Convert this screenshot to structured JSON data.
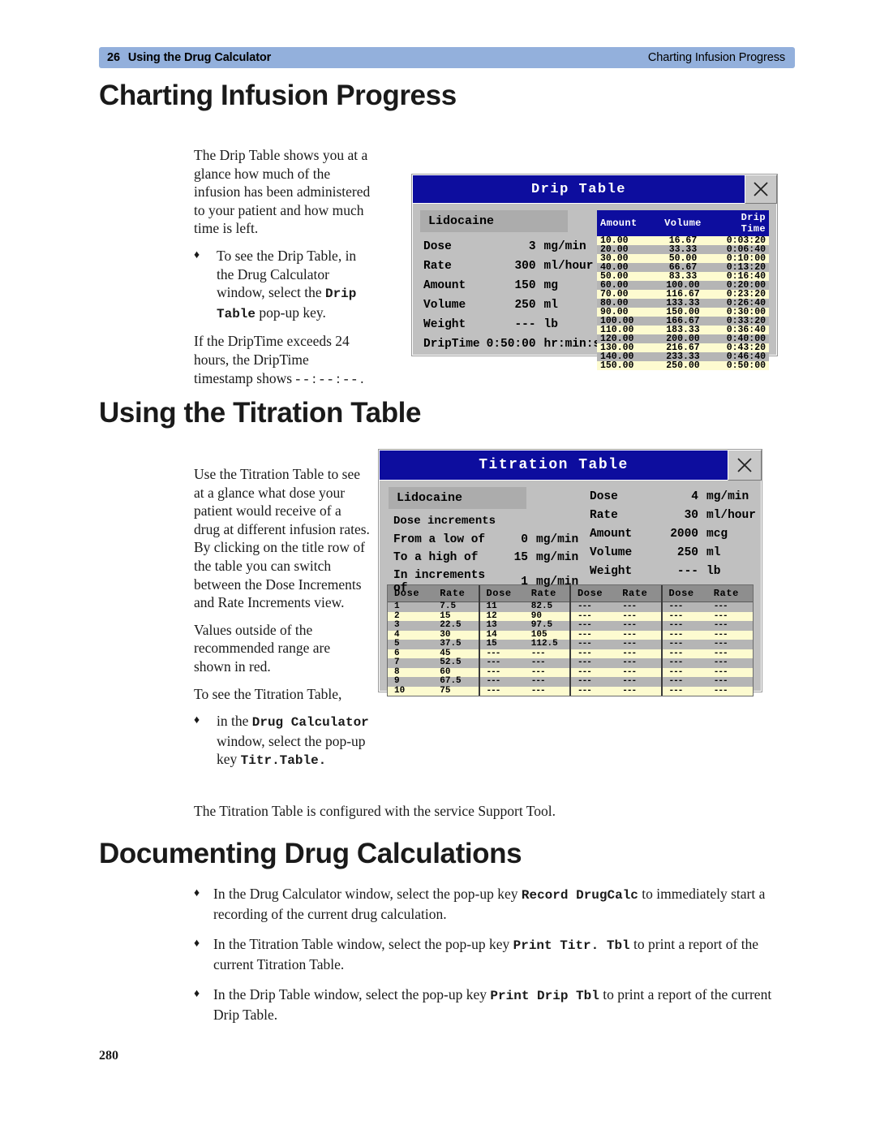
{
  "running_header": {
    "folio": "26",
    "chapter": "Using the Drug Calculator",
    "section": "Charting Infusion Progress"
  },
  "headings": {
    "charting": "Charting Infusion Progress",
    "titration": "Using the Titration Table",
    "documenting": "Documenting Drug Calculations"
  },
  "page_number": "280",
  "charting_section": {
    "para1": "The Drip Table shows you at a glance how much of the infusion has been administered to your patient and how much time is left.",
    "bullet_mark": "♦",
    "bullet1_pre": "To see the Drip Table, in the Drug Calculator window, select the ",
    "bullet1_mono": "Drip Table",
    "bullet1_post": " pop-up key.",
    "para2": "If the DripTime exceeds 24 hours, the DripTime timestamp shows - - : - - : - - ."
  },
  "titration_section": {
    "para1": "Use the Titration Table to see at a glance what dose your patient would receive of a drug at different infusion rates. By clicking on the title row of the table you can switch between the Dose Increments and Rate Increments view.",
    "para2": "Values outside of the recommended range are shown in red.",
    "para3": "To see the Titration Table,",
    "bullet_mark": "♦",
    "bullet1_pre": "in the ",
    "bullet1_mono1": "Drug Calculator",
    "bullet1_mid": " window, select the pop-up key ",
    "bullet1_mono2": "Titr.Table.",
    "support_tool_line": "The Titration Table is configured with the service Support Tool."
  },
  "documenting_section": {
    "bullet_mark": "♦",
    "items": [
      {
        "pre": "In the Drug Calculator window, select the pop-up key ",
        "mono": "Record DrugCalc",
        "post": " to immediately start a recording of the current drug calculation."
      },
      {
        "pre": "In the Titration Table window, select the pop-up key ",
        "mono": "Print Titr. Tbl",
        "post": " to print a report of the current Titration Table."
      },
      {
        "pre": "In the Drip Table window, select the pop-up key ",
        "mono": "Print Drip Tbl",
        "post": " to print a report of the current Drip Table."
      }
    ]
  },
  "drip_window": {
    "title": "Drip Table",
    "close_icon": "close-icon",
    "drug_name": "Lidocaine",
    "params": [
      {
        "label": "Dose",
        "value": "3",
        "unit": "mg/min"
      },
      {
        "label": "Rate",
        "value": "300",
        "unit": "ml/hour"
      },
      {
        "label": "Amount",
        "value": "150",
        "unit": "mg"
      },
      {
        "label": "Volume",
        "value": "250",
        "unit": "ml"
      },
      {
        "label": "Weight",
        "value": "---",
        "unit": "lb"
      },
      {
        "label": "DripTime",
        "value": "0:50:00",
        "unit": "hr:min:sec"
      }
    ],
    "grid_headers": [
      "Amount",
      "Volume",
      "Drip Time"
    ],
    "grid_rows": [
      [
        "10.00",
        "16.67",
        "0:03:20"
      ],
      [
        "20.00",
        "33.33",
        "0:06:40"
      ],
      [
        "30.00",
        "50.00",
        "0:10:00"
      ],
      [
        "40.00",
        "66.67",
        "0:13:20"
      ],
      [
        "50.00",
        "83.33",
        "0:16:40"
      ],
      [
        "60.00",
        "100.00",
        "0:20:00"
      ],
      [
        "70.00",
        "116.67",
        "0:23:20"
      ],
      [
        "80.00",
        "133.33",
        "0:26:40"
      ],
      [
        "90.00",
        "150.00",
        "0:30:00"
      ],
      [
        "100.00",
        "166.67",
        "0:33:20"
      ],
      [
        "110.00",
        "183.33",
        "0:36:40"
      ],
      [
        "120.00",
        "200.00",
        "0:40:00"
      ],
      [
        "130.00",
        "216.67",
        "0:43:20"
      ],
      [
        "140.00",
        "233.33",
        "0:46:40"
      ],
      [
        "150.00",
        "250.00",
        "0:50:00"
      ]
    ]
  },
  "titration_window": {
    "title": "Titration Table",
    "close_icon": "close-icon",
    "drug_name": "Lidocaine",
    "increments_title": "Dose increments",
    "increments": [
      {
        "label": "From a low of",
        "value": "0",
        "unit": "mg/min"
      },
      {
        "label": "To a high of",
        "value": "15",
        "unit": "mg/min"
      },
      {
        "label": "In increments of",
        "value": "1",
        "unit": "mg/min"
      }
    ],
    "params": [
      {
        "label": "Dose",
        "value": "4",
        "unit": "mg/min"
      },
      {
        "label": "Rate",
        "value": "30",
        "unit": "ml/hour"
      },
      {
        "label": "Amount",
        "value": "2000",
        "unit": "mcg"
      },
      {
        "label": "Volume",
        "value": "250",
        "unit": "ml"
      },
      {
        "label": "Weight",
        "value": "---",
        "unit": "lb"
      }
    ],
    "grid_headers": [
      "Dose",
      "Rate",
      "Dose",
      "Rate",
      "Dose",
      "Rate",
      "Dose",
      "Rate"
    ],
    "grid_rows": [
      [
        {
          "t": "1",
          "c": "black"
        },
        {
          "t": "7.5",
          "c": "black"
        },
        {
          "t": "11",
          "c": "red"
        },
        {
          "t": "82.5",
          "c": "red"
        },
        {
          "t": "---",
          "c": "red"
        },
        {
          "t": "---",
          "c": "red"
        },
        {
          "t": "---",
          "c": "red"
        },
        {
          "t": "---",
          "c": "red"
        }
      ],
      [
        {
          "t": "2",
          "c": "black"
        },
        {
          "t": "15",
          "c": "black"
        },
        {
          "t": "12",
          "c": "red"
        },
        {
          "t": "90",
          "c": "red"
        },
        {
          "t": "---",
          "c": "red"
        },
        {
          "t": "---",
          "c": "red"
        },
        {
          "t": "---",
          "c": "red"
        },
        {
          "t": "---",
          "c": "red"
        }
      ],
      [
        {
          "t": "3",
          "c": "black"
        },
        {
          "t": "22.5",
          "c": "black"
        },
        {
          "t": "13",
          "c": "red"
        },
        {
          "t": "97.5",
          "c": "red"
        },
        {
          "t": "---",
          "c": "red"
        },
        {
          "t": "---",
          "c": "red"
        },
        {
          "t": "---",
          "c": "red"
        },
        {
          "t": "---",
          "c": "red"
        }
      ],
      [
        {
          "t": "4",
          "c": "black"
        },
        {
          "t": "30",
          "c": "black"
        },
        {
          "t": "14",
          "c": "red"
        },
        {
          "t": "105",
          "c": "red"
        },
        {
          "t": "---",
          "c": "red"
        },
        {
          "t": "---",
          "c": "red"
        },
        {
          "t": "---",
          "c": "red"
        },
        {
          "t": "---",
          "c": "red"
        }
      ],
      [
        {
          "t": "5",
          "c": "black"
        },
        {
          "t": "37.5",
          "c": "black"
        },
        {
          "t": "15",
          "c": "red"
        },
        {
          "t": "112.5",
          "c": "red"
        },
        {
          "t": "---",
          "c": "red"
        },
        {
          "t": "---",
          "c": "red"
        },
        {
          "t": "---",
          "c": "red"
        },
        {
          "t": "---",
          "c": "red"
        }
      ],
      [
        {
          "t": "6",
          "c": "black"
        },
        {
          "t": "45",
          "c": "black"
        },
        {
          "t": "---",
          "c": "red"
        },
        {
          "t": "---",
          "c": "red"
        },
        {
          "t": "---",
          "c": "red"
        },
        {
          "t": "---",
          "c": "red"
        },
        {
          "t": "---",
          "c": "red"
        },
        {
          "t": "---",
          "c": "red"
        }
      ],
      [
        {
          "t": "7",
          "c": "red"
        },
        {
          "t": "52.5",
          "c": "red"
        },
        {
          "t": "---",
          "c": "red"
        },
        {
          "t": "---",
          "c": "red"
        },
        {
          "t": "---",
          "c": "red"
        },
        {
          "t": "---",
          "c": "red"
        },
        {
          "t": "---",
          "c": "red"
        },
        {
          "t": "---",
          "c": "red"
        }
      ],
      [
        {
          "t": "8",
          "c": "red"
        },
        {
          "t": "60",
          "c": "red"
        },
        {
          "t": "---",
          "c": "red"
        },
        {
          "t": "---",
          "c": "red"
        },
        {
          "t": "---",
          "c": "red"
        },
        {
          "t": "---",
          "c": "red"
        },
        {
          "t": "---",
          "c": "red"
        },
        {
          "t": "---",
          "c": "red"
        }
      ],
      [
        {
          "t": "9",
          "c": "red"
        },
        {
          "t": "67.5",
          "c": "red"
        },
        {
          "t": "---",
          "c": "red"
        },
        {
          "t": "---",
          "c": "red"
        },
        {
          "t": "---",
          "c": "red"
        },
        {
          "t": "---",
          "c": "red"
        },
        {
          "t": "---",
          "c": "red"
        },
        {
          "t": "---",
          "c": "red"
        }
      ],
      [
        {
          "t": "10",
          "c": "red"
        },
        {
          "t": "75",
          "c": "red"
        },
        {
          "t": "---",
          "c": "red"
        },
        {
          "t": "---",
          "c": "red"
        },
        {
          "t": "---",
          "c": "red"
        },
        {
          "t": "---",
          "c": "red"
        },
        {
          "t": "---",
          "c": "red"
        },
        {
          "t": "---",
          "c": "red"
        }
      ]
    ]
  },
  "colors": {
    "header_band": "#93b0dc",
    "titlebar_blue": "#0d0d9e",
    "row_yellow": "#fdfbd0",
    "row_gray": "#b5b5b5",
    "out_of_range_red": "#d40000",
    "window_face": "#c0c0c0"
  }
}
